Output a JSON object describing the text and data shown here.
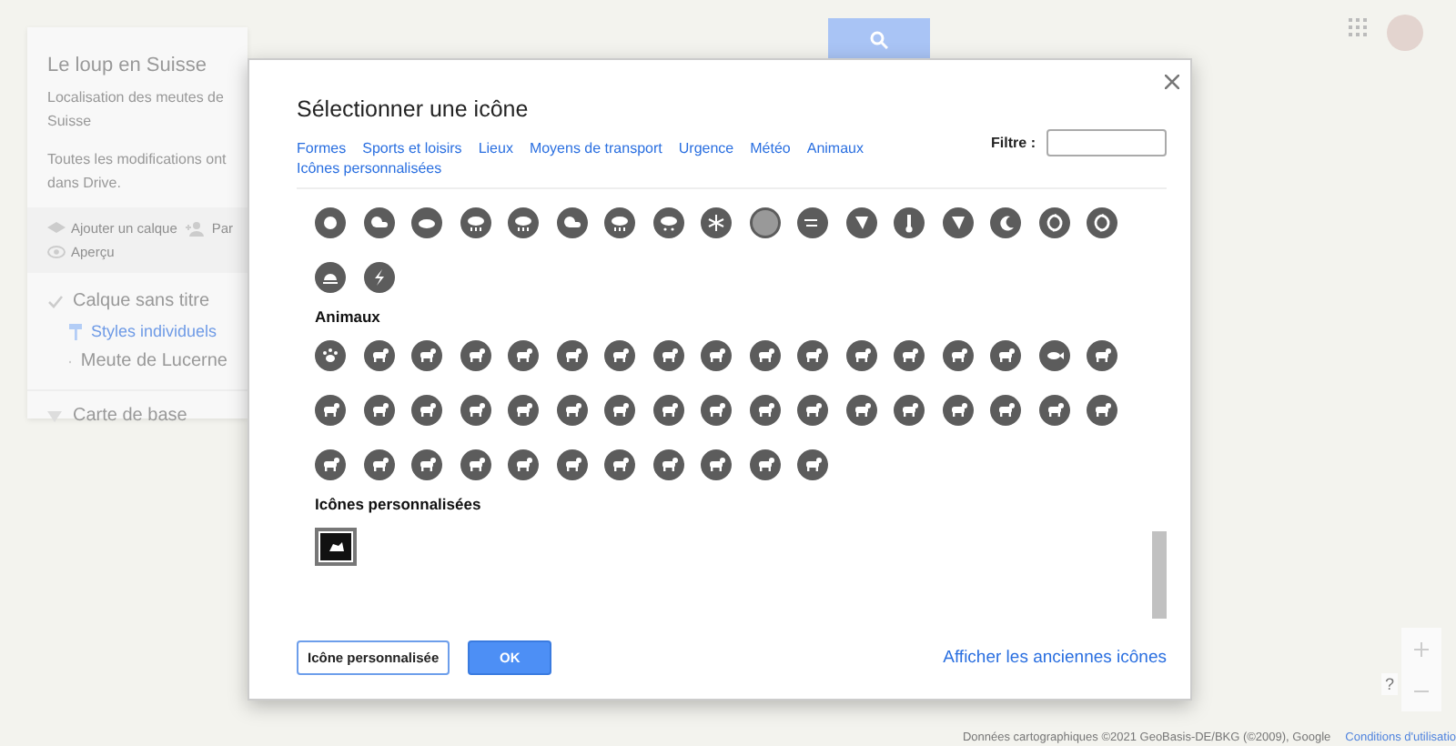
{
  "map_panel": {
    "title": "Le loup en Suisse",
    "description_lines": [
      "Localisation des meutes de",
      "Suisse"
    ],
    "save_status_lines": [
      "Toutes les modifications ont",
      "dans Drive."
    ],
    "actions": [
      {
        "kind": "add-layer",
        "label": "Ajouter un calque"
      },
      {
        "kind": "share",
        "label": "Par"
      },
      {
        "kind": "preview",
        "label": "Aperçu"
      }
    ],
    "layer": {
      "title": "Calque sans titre",
      "checked": true,
      "style": "Styles individuels",
      "feature": "Meute de Lucerne"
    },
    "base_map": "Carte de base"
  },
  "map_controls": {
    "help": "?"
  },
  "attribution": {
    "data": "Données cartographiques ©2021 GeoBasis-DE/BKG (©2009), Google",
    "terms": "Conditions d'utilisatio"
  },
  "dialog": {
    "title": "Sélectionner une icône",
    "categories": [
      "Formes",
      "Sports et loisirs",
      "Lieux",
      "Moyens de transport",
      "Urgence",
      "Météo",
      "Animaux",
      "Icônes personnalisées"
    ],
    "filter": {
      "label": "Filtre :"
    },
    "sections": [
      {
        "icons": [
          {
            "kind": "sun"
          },
          {
            "kind": "cloud-sun"
          },
          {
            "kind": "cloud"
          },
          {
            "kind": "cloud-rain"
          },
          {
            "kind": "cloud-rain"
          },
          {
            "kind": "cloud-sun"
          },
          {
            "kind": "cloud-rain"
          },
          {
            "kind": "cloud-snow"
          },
          {
            "kind": "snowflake"
          },
          {
            "kind": "fog"
          },
          {
            "kind": "wind"
          },
          {
            "kind": "tornado"
          },
          {
            "kind": "thermometer"
          },
          {
            "kind": "tornado"
          },
          {
            "kind": "moon"
          },
          {
            "kind": "hurricane"
          },
          {
            "kind": "hurricane"
          },
          {
            "kind": "sunset"
          },
          {
            "kind": "lightning"
          }
        ]
      },
      {
        "title": "Animaux",
        "icons": [
          {
            "kind": "paw"
          },
          {
            "kind": "animal"
          },
          {
            "kind": "animal"
          },
          {
            "kind": "animal"
          },
          {
            "kind": "animal"
          },
          {
            "kind": "animal"
          },
          {
            "kind": "animal"
          },
          {
            "kind": "animal"
          },
          {
            "kind": "animal"
          },
          {
            "kind": "animal"
          },
          {
            "kind": "animal"
          },
          {
            "kind": "animal"
          },
          {
            "kind": "animal"
          },
          {
            "kind": "animal"
          },
          {
            "kind": "animal"
          },
          {
            "kind": "fish"
          },
          {
            "kind": "animal"
          },
          {
            "kind": "animal"
          },
          {
            "kind": "animal"
          },
          {
            "kind": "animal"
          },
          {
            "kind": "animal"
          },
          {
            "kind": "animal"
          },
          {
            "kind": "animal"
          },
          {
            "kind": "animal"
          },
          {
            "kind": "animal"
          },
          {
            "kind": "animal"
          },
          {
            "kind": "animal"
          },
          {
            "kind": "animal"
          },
          {
            "kind": "animal"
          },
          {
            "kind": "animal"
          },
          {
            "kind": "animal"
          },
          {
            "kind": "animal"
          },
          {
            "kind": "animal"
          },
          {
            "kind": "animal"
          },
          {
            "kind": "animal"
          },
          {
            "kind": "animal"
          },
          {
            "kind": "animal"
          },
          {
            "kind": "animal"
          },
          {
            "kind": "animal"
          },
          {
            "kind": "animal"
          },
          {
            "kind": "animal"
          },
          {
            "kind": "animal"
          },
          {
            "kind": "animal"
          },
          {
            "kind": "animal"
          },
          {
            "kind": "animal"
          }
        ]
      },
      {
        "title": "Icônes personnalisées",
        "custom": [
          {
            "selected": true
          }
        ]
      }
    ],
    "buttons": [
      {
        "kind": "secondary",
        "label": "Icône personnalisée"
      },
      {
        "kind": "primary",
        "label": "OK"
      }
    ],
    "link": "Afficher les anciennes icônes"
  }
}
